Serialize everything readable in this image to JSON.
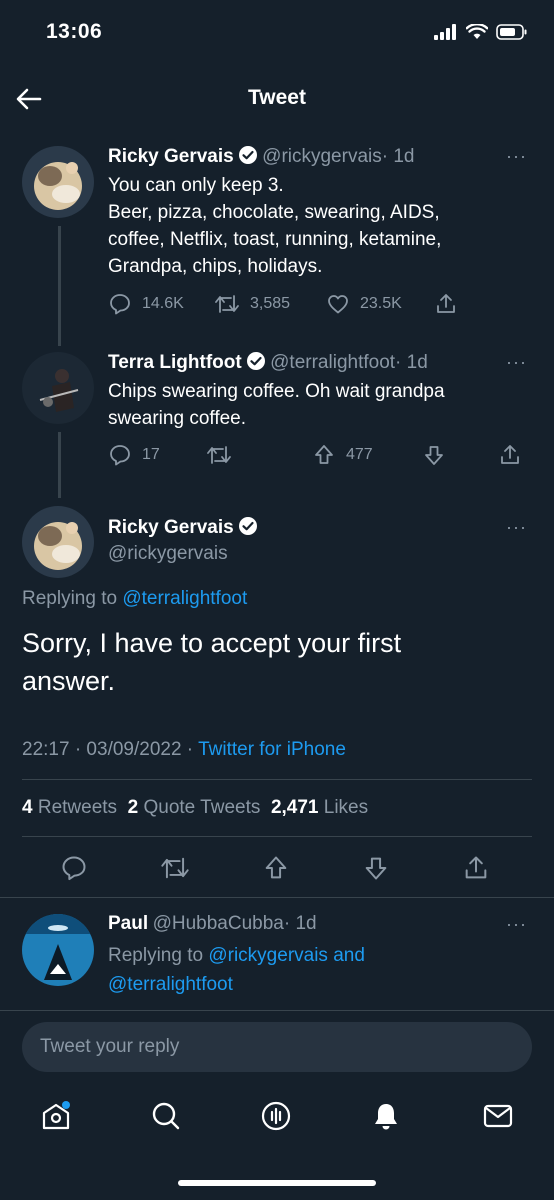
{
  "status_bar": {
    "time": "13:06"
  },
  "header": {
    "title": "Tweet"
  },
  "tweet1": {
    "name": "Ricky Gervais",
    "handle": "@rickygervais",
    "time": "· 1d",
    "text_line1": "You can only keep 3.",
    "text_line2": "Beer, pizza, chocolate, swearing, AIDS,",
    "text_line3": "coffee, Netflix, toast, running, ketamine,",
    "text_line4": "Grandpa, chips, holidays.",
    "replies": "14.6K",
    "retweets": "3,585",
    "likes": "23.5K"
  },
  "tweet2": {
    "name": "Terra Lightfoot",
    "handle": "@terralightfoot",
    "time": "· 1d",
    "text_line1": "Chips swearing coffee. Oh wait grandpa",
    "text_line2": "swearing coffee.",
    "replies": "17",
    "upvotes": "477"
  },
  "main_tweet": {
    "name": "Ricky Gervais",
    "handle": "@rickygervais",
    "replying_prefix": "Replying to",
    "replying_to": "@terralightfoot",
    "text_line1": "Sorry, I have to accept your first",
    "text_line2": "answer.",
    "timestamp": "22:17 · 03/09/2022 ·",
    "source": "Twitter for iPhone",
    "retweets_count": "4",
    "retweets_label": "Retweets",
    "quotes_count": "2",
    "quotes_label": "Quote Tweets",
    "likes_count": "2,471",
    "likes_label": "Likes"
  },
  "reply1": {
    "name": "Paul",
    "handle": "@HubbaCubba",
    "time": "· 1d",
    "replying_prefix": "Replying to",
    "replying_to_line1": "@rickygervais and",
    "replying_to_line2": "@terralightfoot"
  },
  "compose": {
    "placeholder": "Tweet your reply"
  },
  "colors": {
    "background": "#15202b",
    "accent": "#1d9bf0",
    "muted": "#8b98a5",
    "divider": "#38444d"
  },
  "icons": [
    "back-arrow-icon",
    "verified-icon",
    "reply-icon",
    "retweet-icon",
    "like-icon",
    "share-icon",
    "upvote-icon",
    "downvote-icon",
    "home-icon",
    "search-icon",
    "spaces-icon",
    "notifications-icon",
    "messages-icon"
  ]
}
